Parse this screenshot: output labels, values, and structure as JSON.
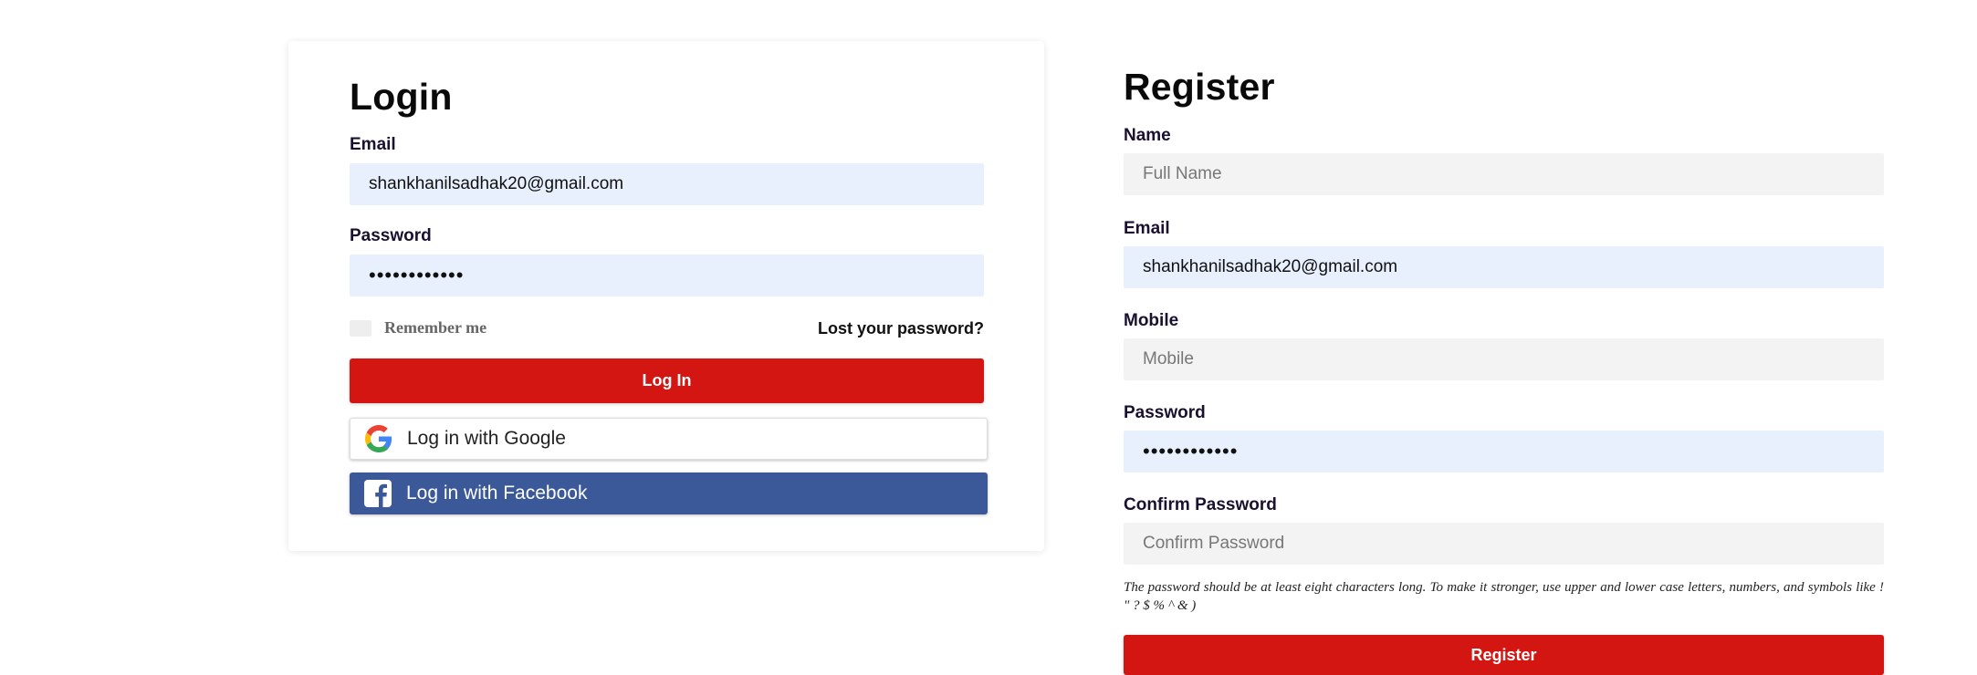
{
  "login": {
    "title": "Login",
    "email_label": "Email",
    "email_value": "shankhanilsadhak20@gmail.com",
    "password_label": "Password",
    "password_value": "••••••••••••",
    "remember_label": "Remember me",
    "lost_password_link": "Lost your password?",
    "login_button": "Log In",
    "google_button": "Log in with Google",
    "facebook_button": "Log in with Facebook"
  },
  "register": {
    "title": "Register",
    "name_label": "Name",
    "name_placeholder": "Full Name",
    "email_label": "Email",
    "email_value": "shankhanilsadhak20@gmail.com",
    "mobile_label": "Mobile",
    "mobile_placeholder": "Mobile",
    "password_label": "Password",
    "password_value": "••••••••••••",
    "confirm_label": "Confirm Password",
    "confirm_placeholder": "Confirm Password",
    "hint": "The password should be at least eight characters long. To make it stronger, use upper and lower case letters, numbers, and symbols like ! \" ? $ % ^ & )",
    "register_button": "Register"
  },
  "colors": {
    "primary_red": "#d31611",
    "facebook_blue": "#3b5998",
    "autofill_blue": "#e8effd",
    "input_grey": "#f3f3f3"
  },
  "icons": {
    "google": "google-g-icon",
    "facebook": "facebook-f-icon"
  }
}
